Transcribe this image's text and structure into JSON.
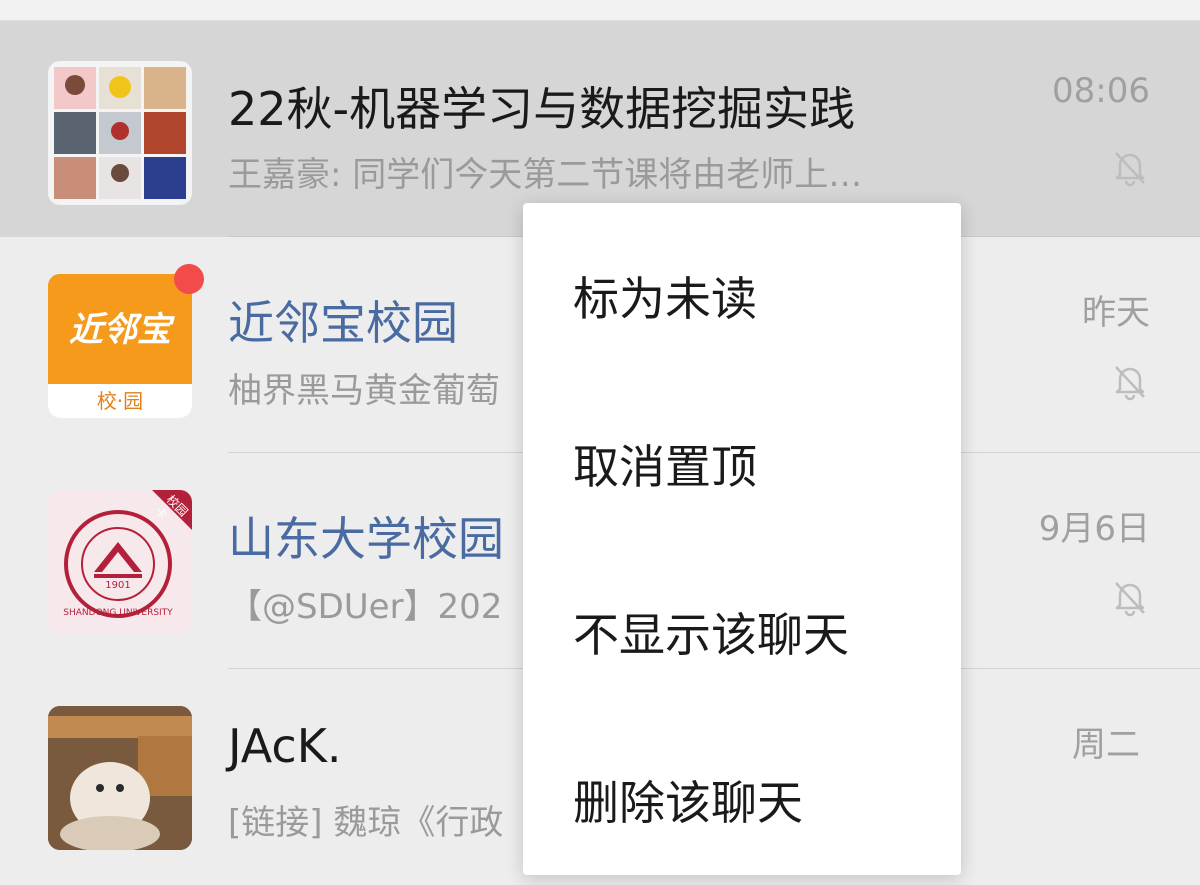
{
  "chats": [
    {
      "title": "22秋-机器学习与数据挖掘实践",
      "preview": "王嘉豪: 同学们今天第二节课将由老师上…",
      "time": "08:06"
    },
    {
      "title": "近邻宝校园",
      "preview": "柚界黑马黄金葡萄",
      "time": "昨天",
      "avatar_text": "近邻宝",
      "avatar_sub": "校·园"
    },
    {
      "title": "山东大学校园",
      "preview": "【@SDUer】202",
      "time": "9月6日",
      "avatar_year": "1901",
      "avatar_ring": "SHANDONG UNIVERSITY",
      "avatar_ribbon": "校园卡"
    },
    {
      "title": "JAcK.",
      "preview": "[链接] 魏琼《行政",
      "time": "周二"
    }
  ],
  "context_menu": {
    "items": [
      "标为未读",
      "取消置顶",
      "不显示该聊天",
      "删除该聊天"
    ]
  },
  "colors": {
    "pinned_bg": "#d6d6d6",
    "list_bg": "#ededed",
    "title_link": "#4a6ba1",
    "badge": "#f34a4a",
    "jinlinbao_orange": "#f59a1b",
    "sdu_red": "#b3203a"
  }
}
